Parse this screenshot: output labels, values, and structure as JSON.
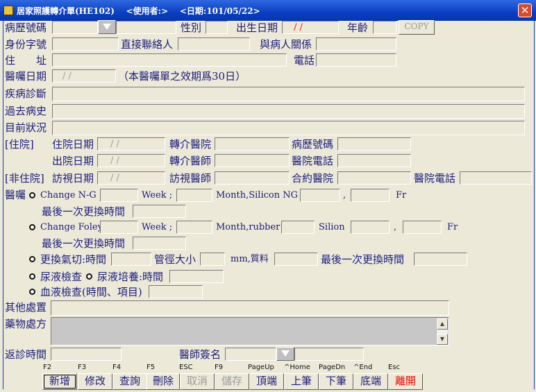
{
  "window": {
    "title": "居家照護轉介單(HE102)    <使用者:>    <日期:101/05/22>",
    "close_glyph": "✕"
  },
  "labels": {
    "chart_no": "病歷號碼",
    "sex": "性別",
    "birth": "出生日期",
    "age": "年齡",
    "id_no": "身份字號",
    "contact": "直接聯絡人",
    "relation": "與病人關係",
    "address": "住　　址",
    "phone": "電話",
    "order_date": "醫囑日期",
    "validity_note": "（本醫囑單之效期爲30日）",
    "diagnosis": "疾病診斷",
    "history": "過去病史",
    "status": "目前狀況",
    "inpatient": "[住院]",
    "admit_date": "住院日期",
    "ref_hosp": "轉介醫院",
    "hosp_chart_no": "病歷號碼",
    "discharge_date": "出院日期",
    "ref_doctor": "轉介醫師",
    "hosp_phone": "醫院電話",
    "outpatient": "[非住院]",
    "visit_date": "訪視日期",
    "visit_doctor": "訪視醫師",
    "contract_hosp": "合約醫院",
    "hosp_phone2": "醫院電話",
    "order": "醫囑",
    "change_ng": "Change N-G",
    "week1": "Week ;",
    "month_silicon": "Month,Silicon  NG",
    "comma1": ",",
    "fr1": "Fr",
    "last_change1": "最後一次更換時間",
    "change_foley": "Change Foley",
    "week2": "Week ;",
    "month_rubber": "Month,rubber",
    "silion": "Silion",
    "comma2": ",",
    "fr2": "Fr",
    "last_change2": "最後一次更換時間",
    "trach": "更換氣切:時間",
    "tube_size": "管徑大小",
    "mm_material": "mm,質料",
    "last_change3": "最後一次更換時間",
    "urine_test": "尿液檢查",
    "urine_culture": "尿液培養:時間",
    "blood_test": "血液檢查(時間、項目)",
    "other": "其他處置",
    "medication": "藥物處方",
    "return_time": "返診時間",
    "doctor_sign": "醫師簽名"
  },
  "values": {
    "birth_date": "/  /",
    "order_date": "/  /",
    "admit_date": "/  /",
    "discharge_date": "/  /",
    "visit_date": "/  /"
  },
  "buttons": {
    "copy": "COPY"
  },
  "keys": [
    "F2",
    "F3",
    "F4",
    "F5",
    "ESC",
    "F9",
    "PageUp",
    "^Home",
    "PageDn",
    "^End",
    "Esc"
  ],
  "toolbar": [
    "新增",
    "修改",
    "查詢",
    "刪除",
    "取消",
    "儲存",
    "頂端",
    "上筆",
    "下筆",
    "底端",
    "離開"
  ],
  "colors": {
    "title_bar": "#0a3fc3",
    "label_text": "#1c1c7a",
    "date_text": "#e11"
  }
}
